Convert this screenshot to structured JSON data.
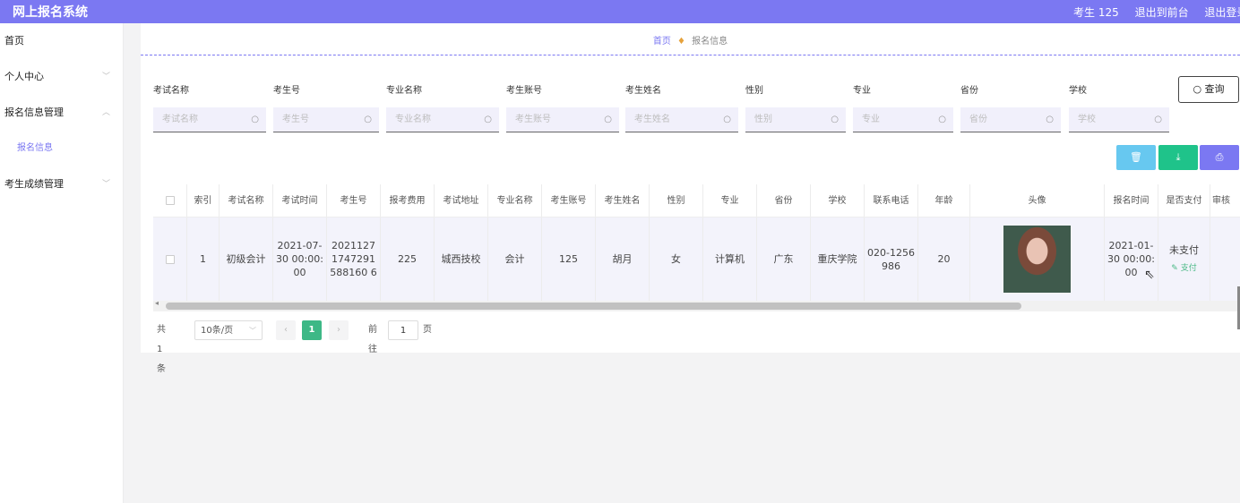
{
  "app": {
    "title": "网上报名系统"
  },
  "topbar": {
    "user": "考生 125",
    "back_front": "退出到前台",
    "logout": "退出登录"
  },
  "sidebar": {
    "items": [
      {
        "label": "首页"
      },
      {
        "label": "个人中心"
      },
      {
        "label": "报名信息管理"
      },
      {
        "label": "报名信息"
      },
      {
        "label": "考生成绩管理"
      }
    ]
  },
  "breadcrumb": {
    "home": "首页",
    "current": "报名信息"
  },
  "filters": [
    {
      "label": "考试名称",
      "placeholder": "考试名称"
    },
    {
      "label": "考生号",
      "placeholder": "考生号"
    },
    {
      "label": "专业名称",
      "placeholder": "专业名称"
    },
    {
      "label": "考生账号",
      "placeholder": "考生账号"
    },
    {
      "label": "考生姓名",
      "placeholder": "考生姓名"
    },
    {
      "label": "性别",
      "placeholder": "性别"
    },
    {
      "label": "专业",
      "placeholder": "专业"
    },
    {
      "label": "省份",
      "placeholder": "省份"
    },
    {
      "label": "学校",
      "placeholder": "学校"
    }
  ],
  "search_button": {
    "label": "查询",
    "icon": "search-icon"
  },
  "actions": {
    "delete_icon": "trash-icon",
    "export_icon": "download-icon",
    "print_icon": "print-icon",
    "colors": {
      "delete": "#67c8f0",
      "export": "#1fc38a",
      "print": "#7b78f2"
    }
  },
  "table": {
    "headers": [
      "索引",
      "考试名称",
      "考试时间",
      "考生号",
      "报考费用",
      "考试地址",
      "专业名称",
      "考生账号",
      "考生姓名",
      "性别",
      "专业",
      "省份",
      "学校",
      "联系电话",
      "年龄",
      "头像",
      "报名时间",
      "是否支付",
      "审核"
    ],
    "rows": [
      {
        "index": "1",
        "exam_name": "初级会计",
        "exam_time": "2021-07-30 00:00:00",
        "student_no": "20211271747291588160 6",
        "fee": "225",
        "address": "城西技校",
        "major_name": "会计",
        "account": "125",
        "name": "胡月",
        "gender": "女",
        "major": "计算机",
        "province": "广东",
        "school": "重庆学院",
        "phone": "020-1256986",
        "age": "20",
        "signup_time": "2021-01-30 00:00:00",
        "paid": "未支付",
        "pay_link": "支付"
      }
    ]
  },
  "pagination": {
    "total": "共 1 条",
    "page_size": "10条/页",
    "current_page": "1",
    "goto_label": "前往",
    "goto_value": "1",
    "page_suffix": "页"
  }
}
